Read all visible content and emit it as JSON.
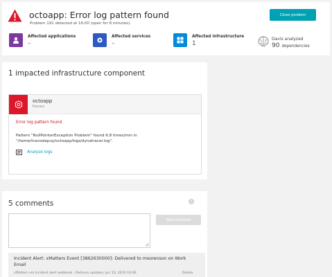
{
  "header": {
    "title": "octoapp: Error log pattern found",
    "subtitle": "Problem 191 detected at 16:00 (open for 8 minutes).",
    "close_button": "Close problem",
    "affected": [
      {
        "label": "Affected applications",
        "value": "–",
        "icon": "user-icon",
        "color": "#7c38a1"
      },
      {
        "label": "Affected services",
        "value": "–",
        "icon": "gear-icon",
        "color": "#2c5ac2"
      },
      {
        "label": "Affected infrastructure",
        "value": "1",
        "icon": "grid-icon",
        "color": "#008cdb"
      }
    ],
    "davis": {
      "line1": "Davis analyzed",
      "count": "90",
      "unit": "dependencies",
      "icon": "brain-icon"
    }
  },
  "impacted": {
    "title": "1 impacted infrastructure component",
    "card": {
      "name": "octoapp",
      "type": "Process",
      "icon": "process-icon",
      "error_title": "Error log pattern found",
      "description": "Pattern \"NullPointerException Problem\" found 6.8 times/min in \"/home/travisdepuy/octoapp/logs/dynatracer.log\".",
      "analyze_link": "Analyze logs"
    }
  },
  "comments": {
    "title": "5 comments",
    "textarea_value": "",
    "add_button": "Add comment",
    "items": [
      {
        "title": "Incident Alert: xMatters Event [3862630000]: Delivered to msorenson on Work Email",
        "meta": "xMatters via Incident alert webhook - Delivery updates, Jun 10, 2019 16:06",
        "delete": "Delete"
      }
    ]
  },
  "colors": {
    "accent": "#00a1b2",
    "error": "#dc172a",
    "panel": "#ffffff",
    "background": "#f2f2f2"
  }
}
